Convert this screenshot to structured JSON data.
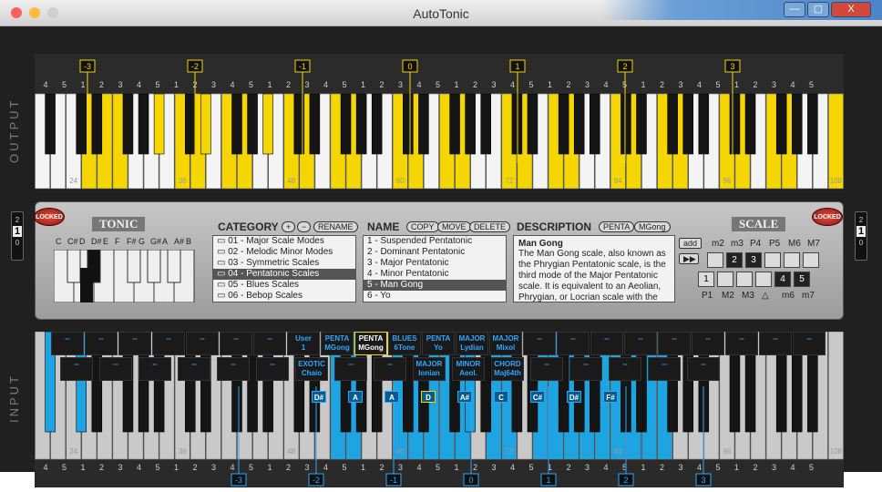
{
  "window": {
    "title": "AutoTonic",
    "minimize": "—",
    "maximize": "▢",
    "close": "X"
  },
  "output": {
    "side_label": "OUTPUT",
    "octave_tags": [
      "-3",
      "-2",
      "-1",
      "0",
      "1",
      "2",
      "3"
    ],
    "c_labels": [
      "24",
      "36",
      "48",
      "60",
      "72",
      "84",
      "96",
      "108"
    ],
    "finger_row": [
      "4",
      "5",
      "1",
      "2",
      "3",
      "4",
      "5",
      "1",
      "2",
      "3",
      "4",
      "5",
      "1",
      "2",
      "3",
      "4",
      "5",
      "1",
      "2",
      "3",
      "4",
      "5",
      "1",
      "2",
      "3",
      "4",
      "5",
      "1",
      "2",
      "3",
      "4",
      "5",
      "1",
      "2",
      "3",
      "4",
      "5",
      "1",
      "2",
      "3",
      "4",
      "5"
    ]
  },
  "input": {
    "side_label": "INPUT",
    "octave_tags": [
      "-3",
      "-2",
      "-1",
      "0",
      "1",
      "2",
      "3"
    ],
    "c_labels": [
      "24",
      "36",
      "48",
      "60",
      "72",
      "84",
      "96",
      "108"
    ],
    "finger_row": [
      "4",
      "5",
      "1",
      "2",
      "3",
      "4",
      "5",
      "1",
      "2",
      "3",
      "4",
      "5",
      "1",
      "2",
      "3",
      "4",
      "5",
      "1",
      "2",
      "3",
      "4",
      "5",
      "1",
      "2",
      "3",
      "4",
      "5",
      "1",
      "2",
      "3",
      "4",
      "5",
      "1",
      "2",
      "3",
      "4",
      "5",
      "1",
      "2",
      "3",
      "4",
      "5"
    ],
    "pad_labels_top": [
      {
        "l1": "--",
        "l2": ""
      },
      {
        "l1": "--",
        "l2": ""
      },
      {
        "l1": "--",
        "l2": ""
      },
      {
        "l1": "--",
        "l2": ""
      },
      {
        "l1": "--",
        "l2": ""
      },
      {
        "l1": "--",
        "l2": ""
      },
      {
        "l1": "--",
        "l2": ""
      },
      {
        "l1": "User",
        "l2": "1"
      },
      {
        "l1": "PENTA",
        "l2": "MGong"
      },
      {
        "l1": "PENTA",
        "l2": "MGong"
      },
      {
        "l1": "BLUES",
        "l2": "6Tone"
      },
      {
        "l1": "PENTA",
        "l2": "Yo"
      },
      {
        "l1": "MAJOR",
        "l2": "Lydian"
      },
      {
        "l1": "MAJOR",
        "l2": "Mixol"
      },
      {
        "l1": "--",
        "l2": ""
      },
      {
        "l1": "--",
        "l2": ""
      },
      {
        "l1": "--",
        "l2": ""
      },
      {
        "l1": "--",
        "l2": ""
      },
      {
        "l1": "--",
        "l2": ""
      },
      {
        "l1": "--",
        "l2": ""
      },
      {
        "l1": "--",
        "l2": ""
      },
      {
        "l1": "--",
        "l2": ""
      },
      {
        "l1": "--",
        "l2": ""
      }
    ],
    "pad_labels_bottom": [
      {
        "l1": "--",
        "l2": ""
      },
      {
        "l1": "--",
        "l2": ""
      },
      {
        "l1": "--",
        "l2": ""
      },
      {
        "l1": "--",
        "l2": ""
      },
      {
        "l1": "--",
        "l2": ""
      },
      {
        "l1": "--",
        "l2": ""
      },
      {
        "l1": "EXOTIC",
        "l2": "Chaio"
      },
      {
        "l1": "--",
        "l2": ""
      },
      {
        "l1": "--",
        "l2": ""
      },
      {
        "l1": "MAJOR",
        "l2": "Ionian"
      },
      {
        "l1": "MINOR",
        "l2": "Aeol."
      },
      {
        "l1": "CHORD",
        "l2": "Maj64th"
      },
      {
        "l1": "--",
        "l2": ""
      },
      {
        "l1": "--",
        "l2": ""
      },
      {
        "l1": "--",
        "l2": ""
      },
      {
        "l1": "--",
        "l2": ""
      },
      {
        "l1": "--",
        "l2": ""
      }
    ],
    "note_tags": [
      "D#",
      "A",
      "A",
      "D",
      "A#",
      "C",
      "C#",
      "D#",
      "F#"
    ]
  },
  "controls": {
    "locked_left": "LOCKED",
    "locked_right": "LOCKED",
    "tonic_title": "TONIC",
    "scale_title": "SCALE",
    "tonic_notes": [
      "C",
      "C#",
      "D",
      "D#",
      "E",
      "F",
      "F#",
      "G",
      "G#",
      "A",
      "A#",
      "B"
    ],
    "category": {
      "header": "CATEGORY",
      "plus": "+",
      "minus": "−",
      "rename": "RENAME",
      "items": [
        "01 - Major Scale Modes",
        "02 - Melodic Minor Modes",
        "03 - Symmetric Scales",
        "04 - Pentatonic Scales",
        "05 - Blues Scales",
        "06 - Bebop Scales"
      ],
      "selected": 3
    },
    "name": {
      "header": "NAME",
      "copy": "COPY",
      "move": "MOVE",
      "delete": "DELETE",
      "items": [
        "1 - Suspended Pentatonic",
        "2 - Dominant Pentatonic",
        "3 - Major Pentatonic",
        "4 - Minor Pentatonic",
        "5 - Man Gong",
        "6 - Yo"
      ],
      "selected": 4
    },
    "description": {
      "header": "DESCRIPTION",
      "tag1": "PENTA",
      "tag2": "MGong",
      "title": "Man Gong",
      "text": "The Man Gong scale, also known as the Phrygian Pentatonic scale, is the third mode of the Major Pentatonic scale. It is equivalent to an Aeolian, Phrygian, or Locrian scale with the"
    },
    "scale": {
      "add": "add",
      "top_intervals": [
        "m2",
        "m3",
        "P4",
        "P5",
        "M6",
        "M7"
      ],
      "bottom_intervals": [
        "P1",
        "M2",
        "M3",
        "△",
        "m6",
        "m7"
      ],
      "upper_cells": [
        "",
        "2",
        "3",
        "",
        "",
        ""
      ],
      "lower_cells": [
        "1",
        "",
        "",
        "",
        "4",
        "5"
      ]
    },
    "spinner_left": {
      "value": "1"
    },
    "spinner_right": {
      "value": "1"
    }
  },
  "colors": {
    "output_active": "#f5d600",
    "input_active": "#1ea4e0",
    "accent_blue": "#2ea7ff"
  }
}
